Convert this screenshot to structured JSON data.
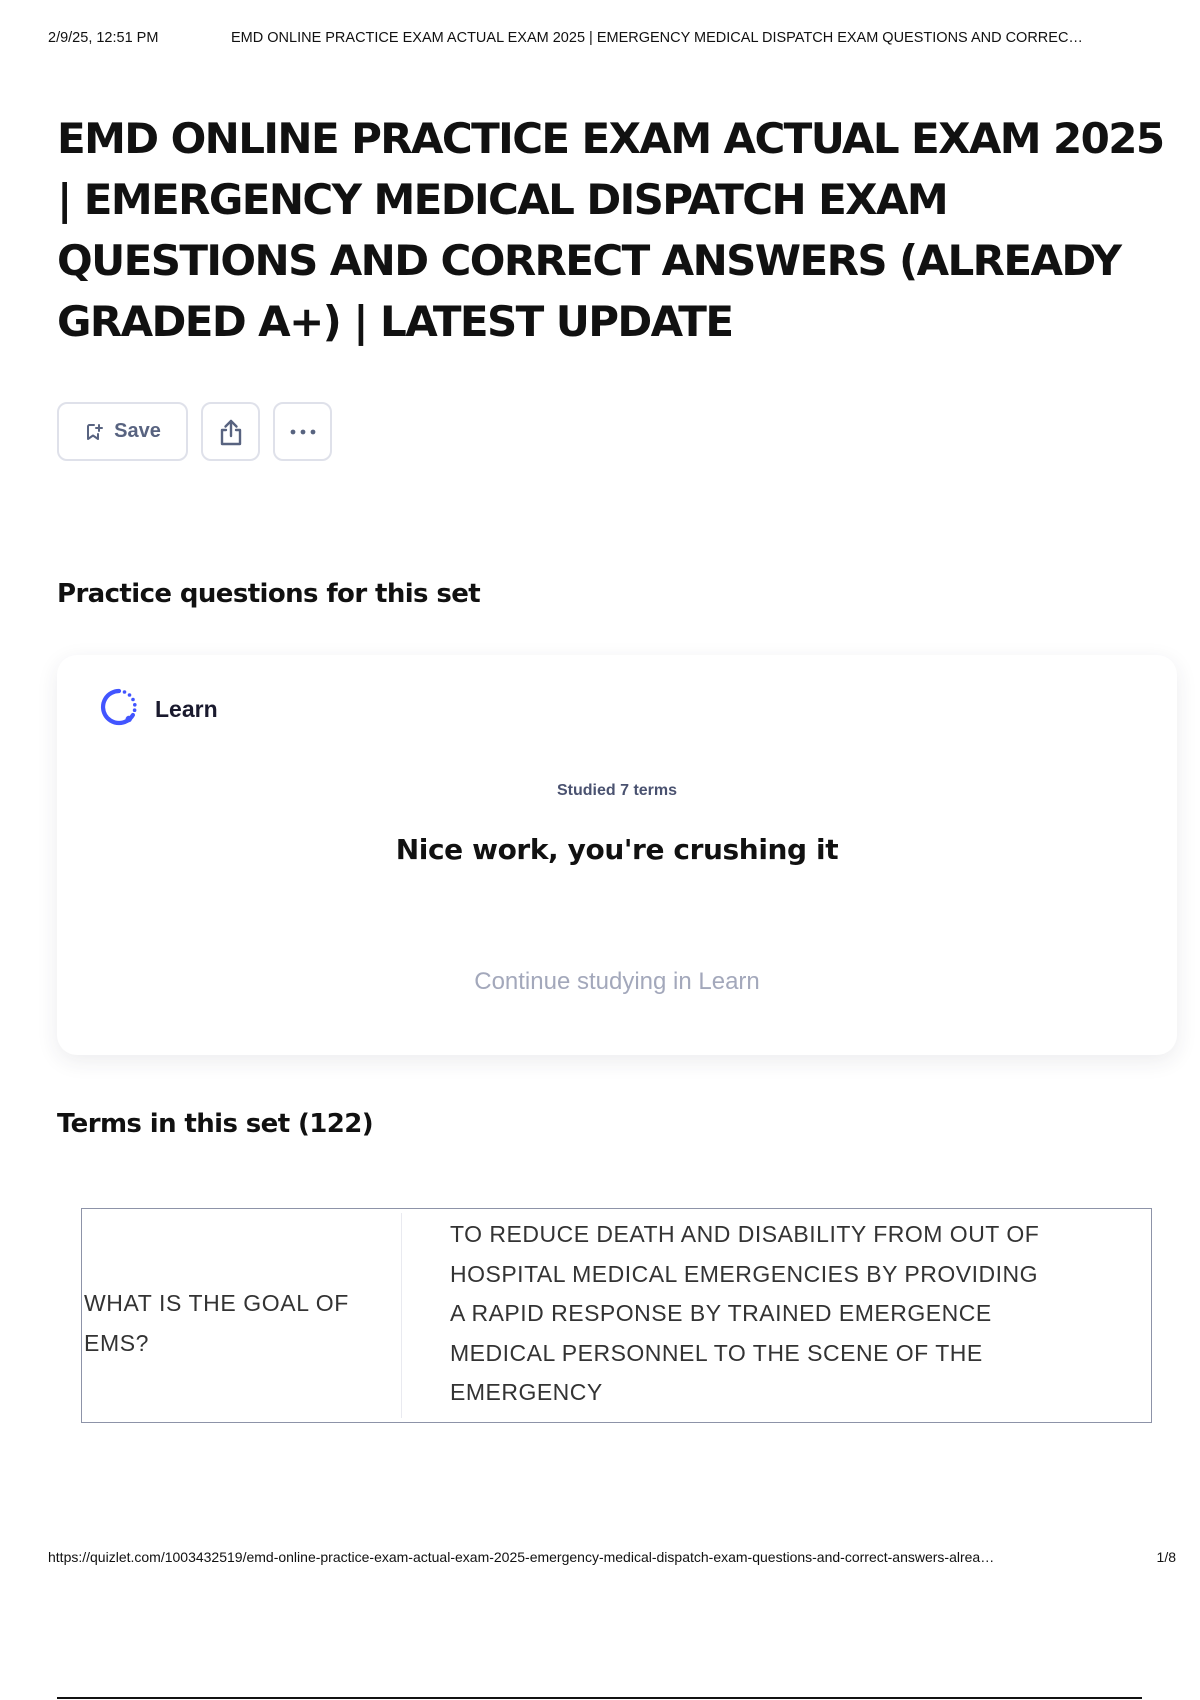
{
  "print_header": {
    "timestamp": "2/9/25, 12:51 PM",
    "doc_title": "EMD ONLINE PRACTICE EXAM ACTUAL EXAM 2025 | EMERGENCY MEDICAL DISPATCH EXAM QUESTIONS AND CORREC…"
  },
  "page_title": "EMD ONLINE PRACTICE EXAM ACTUAL EXAM 2025 | EMERGENCY MEDICAL DISPATCH EXAM QUESTIONS AND CORRECT ANSWERS (ALREADY GRADED A+) | LATEST UPDATE",
  "actions": {
    "save_label": "Save",
    "save_icon": "bookmark-plus-icon",
    "share_icon": "share-icon",
    "more_icon": "more-horizontal-icon"
  },
  "practice": {
    "heading": "Practice questions for this set",
    "learn_label": "Learn",
    "learn_icon": "learn-progress-icon",
    "studied_text": "Studied 7 terms",
    "message": "Nice work, you're crushing it",
    "continue_link": "Continue studying in Learn"
  },
  "terms": {
    "heading": "Terms in this set (122)",
    "items": [
      {
        "term": "WHAT IS THE GOAL OF EMS?",
        "definition": "TO REDUCE DEATH AND DISABILITY FROM OUT OF HOSPITAL MEDICAL EMERGENCIES BY PROVIDING A RAPID RESPONSE BY TRAINED EMERGENCE MEDICAL PERSONNEL TO THE SCENE OF THE EMERGENCY"
      }
    ]
  },
  "print_footer": {
    "url": "https://quizlet.com/1003432519/emd-online-practice-exam-actual-exam-2025-emergency-medical-dispatch-exam-questions-and-correct-answers-alrea…",
    "page": "1/8"
  },
  "colors": {
    "accent": "#4255ff",
    "muted_text": "#586380",
    "border": "#dfe1ea"
  }
}
